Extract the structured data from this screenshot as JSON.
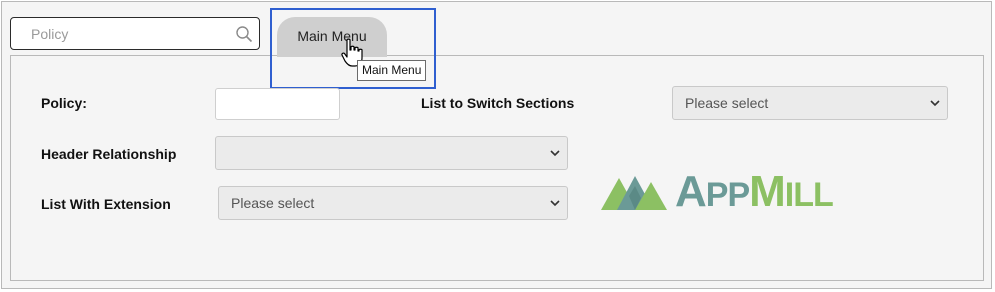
{
  "search": {
    "placeholder": "Policy",
    "icon": "search-icon"
  },
  "tab": {
    "label": "Main Menu",
    "tooltip": "Main Menu"
  },
  "form": {
    "policy_label": "Policy:",
    "policy_value": "",
    "switch_sections_label": "List to Switch Sections",
    "switch_sections_value": "Please select",
    "header_relationship_label": "Header Relationship",
    "header_relationship_value": "",
    "extension_label": "List With Extension",
    "extension_value": "Please select"
  },
  "logo": {
    "text_app_first": "A",
    "text_app_rest": "PP",
    "text_mill_first": "M",
    "text_mill_rest": "ILL",
    "colors": {
      "app": "#6b9a97",
      "mill": "#8cc063"
    }
  },
  "colors": {
    "highlight": "#2f5fd0",
    "tab": "#cfcfcf"
  }
}
